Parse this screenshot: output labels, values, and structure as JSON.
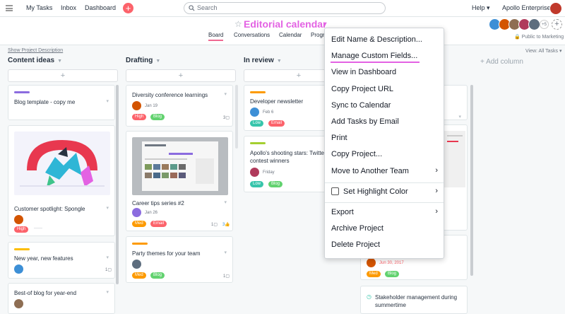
{
  "topbar": {
    "nav": [
      "My Tasks",
      "Inbox",
      "Dashboard"
    ],
    "search_placeholder": "Search",
    "help": "Help",
    "org": "Apollo Enterprises"
  },
  "project": {
    "title": "Editorial calendar",
    "tabs": [
      "Board",
      "Conversations",
      "Calendar",
      "Progr"
    ],
    "active_tab": "Board",
    "member_more": "+5",
    "public": "Public to Marketing",
    "show_desc": "Show Project Description",
    "view_all": "View: All Tasks"
  },
  "columns": [
    {
      "name": "Content ideas",
      "cards": [
        {
          "title": "Blog template - copy me",
          "bar": "#8b6cdf"
        },
        {
          "title": "Customer spotlight: Spongle",
          "tags": [
            "High"
          ]
        },
        {
          "title": "New year, new features",
          "bar": "#fcbd01",
          "comments": "1"
        },
        {
          "title": "Best-of blog for year-end"
        }
      ]
    },
    {
      "name": "Drafting",
      "cards": [
        {
          "title": "Diversity conference learnings",
          "date": "Jan 19",
          "tags": [
            "High",
            "Blog"
          ],
          "comments": "3"
        },
        {
          "title": "Career tips series #2",
          "date": "Jan 26",
          "tags": [
            "Med",
            "Email"
          ],
          "comments": "1",
          "likes": "3"
        },
        {
          "title": "Party themes for your team",
          "bar": "#fd9a00",
          "tags": [
            "Med",
            "Blog"
          ],
          "comments": "1"
        }
      ]
    },
    {
      "name": "In review",
      "cards": [
        {
          "title": "Developer newsletter",
          "bar": "#fd9a00",
          "date": "Feb 6",
          "tags": [
            "Low",
            "Email"
          ]
        },
        {
          "title": "Apollo's shooting stars: Twitter contest winners",
          "bar": "#a4cf30",
          "date": "Friday",
          "tags": [
            "Low",
            "Blog"
          ]
        }
      ]
    }
  ],
  "side_cards": {
    "date": "Jun 30, 2017",
    "tags": [
      "Med",
      "Blog"
    ],
    "title": "Stakeholder management during summertime"
  },
  "add_column": "+ Add column",
  "menu": {
    "items": [
      "Edit Name & Description...",
      "Manage Custom Fields...",
      "View in Dashboard",
      "Copy Project URL",
      "Sync to Calendar",
      "Add Tasks by Email",
      "Print",
      "Copy Project...",
      "Move to Another Team",
      "Set Highlight Color",
      "Export",
      "Archive Project",
      "Delete Project"
    ]
  },
  "colors": {
    "accent": "#e362e3",
    "high": "#fc636b",
    "med": "#fd9a00",
    "low": "#37c5ab",
    "blog": "#62d26f",
    "email": "#fc636b"
  }
}
